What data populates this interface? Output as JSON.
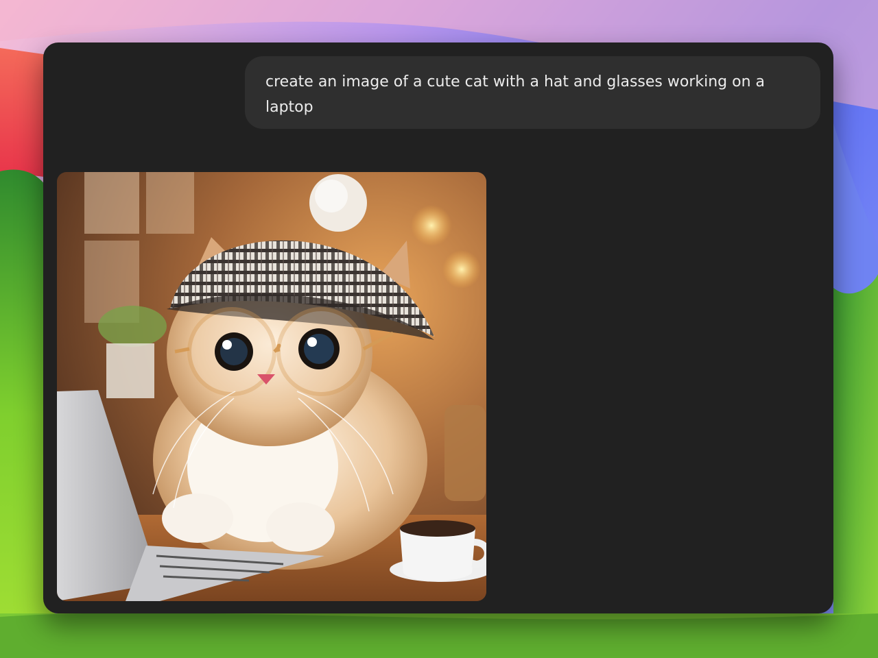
{
  "conversation": {
    "user_message": "create an image of a cute cat with a hat and glasses working on a laptop",
    "assistant_image": {
      "icon": "generated-image",
      "subject": "cat-with-hat-glasses-laptop"
    }
  },
  "colors": {
    "window_bg": "#212121",
    "bubble_bg": "#2f2f2f",
    "text": "#ececec"
  }
}
